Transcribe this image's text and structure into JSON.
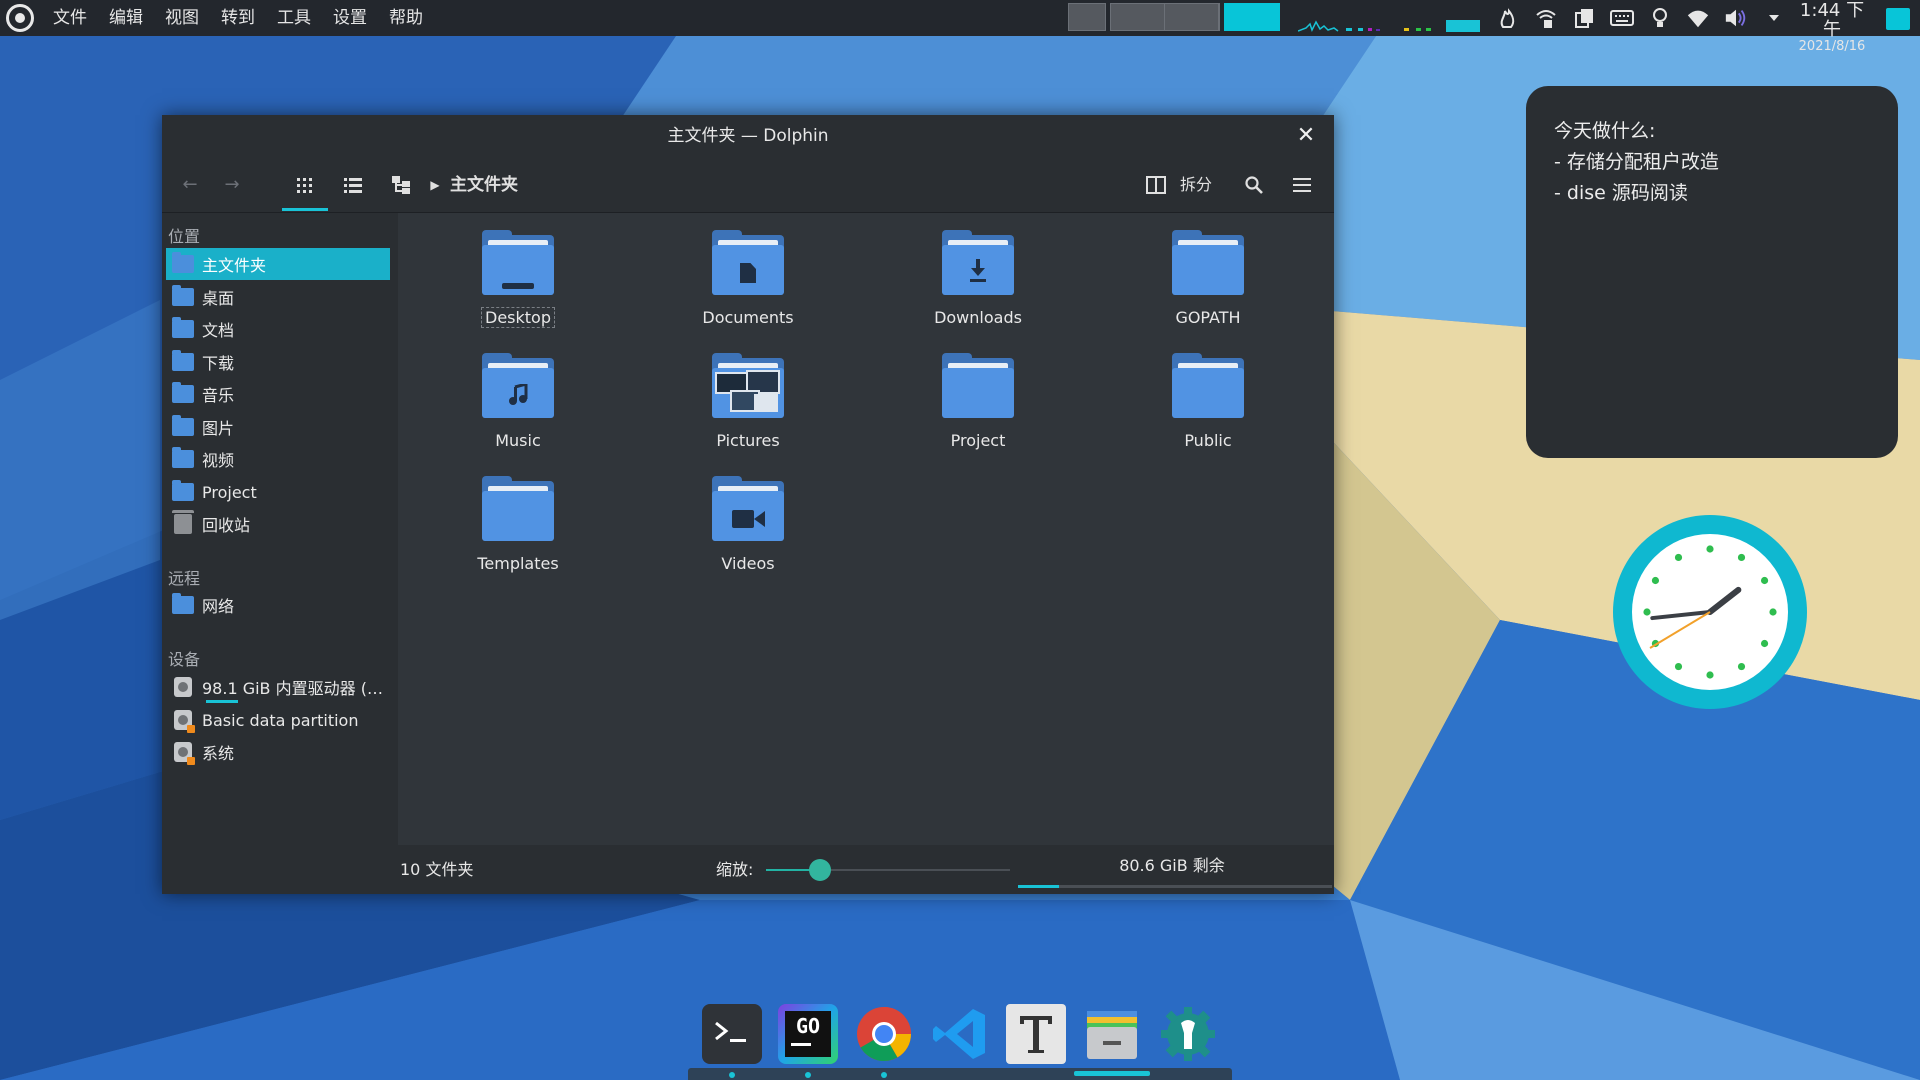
{
  "menubar": {
    "items": [
      "文件",
      "编辑",
      "视图",
      "转到",
      "工具",
      "设置",
      "帮助"
    ]
  },
  "clock": {
    "time": "1:44 下午",
    "date": "2021/8/16"
  },
  "window": {
    "title": "主文件夹 — Dolphin",
    "close_glyph": "✕",
    "toolbar": {
      "back_icon": "arrow-left-icon",
      "forward_icon": "arrow-right-icon",
      "split_label": "拆分",
      "breadcrumb": "主文件夹"
    },
    "sidebar": {
      "places_header": "位置",
      "places": [
        {
          "label": "主文件夹",
          "icon": "home-folder-icon",
          "active": true
        },
        {
          "label": "桌面",
          "icon": "desktop-folder-icon"
        },
        {
          "label": "文档",
          "icon": "documents-folder-icon"
        },
        {
          "label": "下载",
          "icon": "downloads-folder-icon"
        },
        {
          "label": "音乐",
          "icon": "music-folder-icon"
        },
        {
          "label": "图片",
          "icon": "pictures-folder-icon"
        },
        {
          "label": "视频",
          "icon": "videos-folder-icon"
        },
        {
          "label": "Project",
          "icon": "folder-icon"
        },
        {
          "label": "回收站",
          "icon": "trash-icon"
        }
      ],
      "remote_header": "远程",
      "remote": [
        {
          "label": "网络",
          "icon": "network-folder-icon"
        }
      ],
      "devices_header": "设备",
      "devices": [
        {
          "label": "98.1 GiB 内置驱动器 (…",
          "icon": "drive-icon"
        },
        {
          "label": "Basic data partition",
          "icon": "drive-icon"
        },
        {
          "label": "系统",
          "icon": "drive-icon"
        }
      ]
    },
    "folders": [
      {
        "label": "Desktop",
        "icon": "desktop-folder-icon"
      },
      {
        "label": "Documents",
        "icon": "documents-folder-icon"
      },
      {
        "label": "Downloads",
        "icon": "downloads-folder-icon"
      },
      {
        "label": "GOPATH",
        "icon": "folder-icon"
      },
      {
        "label": "Music",
        "icon": "music-folder-icon"
      },
      {
        "label": "Pictures",
        "icon": "pictures-folder-icon"
      },
      {
        "label": "Project",
        "icon": "folder-icon"
      },
      {
        "label": "Public",
        "icon": "folder-icon"
      },
      {
        "label": "Templates",
        "icon": "templates-folder-icon"
      },
      {
        "label": "Videos",
        "icon": "videos-folder-icon"
      }
    ],
    "status": {
      "count": "10 文件夹",
      "zoom_label": "缩放:",
      "zoom_level": 0.22,
      "free_space": "80.6 GiB 剩余",
      "disk_used_fraction": 0.13
    }
  },
  "note": {
    "lines": [
      "今天做什么:",
      "- 存储分配租户改造",
      "- dise 源码阅读"
    ]
  },
  "analog_clock": {
    "hour": 1,
    "minute": 44
  },
  "dock": {
    "apps": [
      "terminal-icon",
      "goland-icon",
      "chrome-icon",
      "vscode-icon",
      "typora-icon",
      "file-manager-icon",
      "settings-icon"
    ]
  },
  "colors": {
    "accent": "#19c3d6",
    "window_bg": "#2a2e32",
    "folder_blue": "#5193e3",
    "sidebar_active": "#1ab0c9"
  }
}
